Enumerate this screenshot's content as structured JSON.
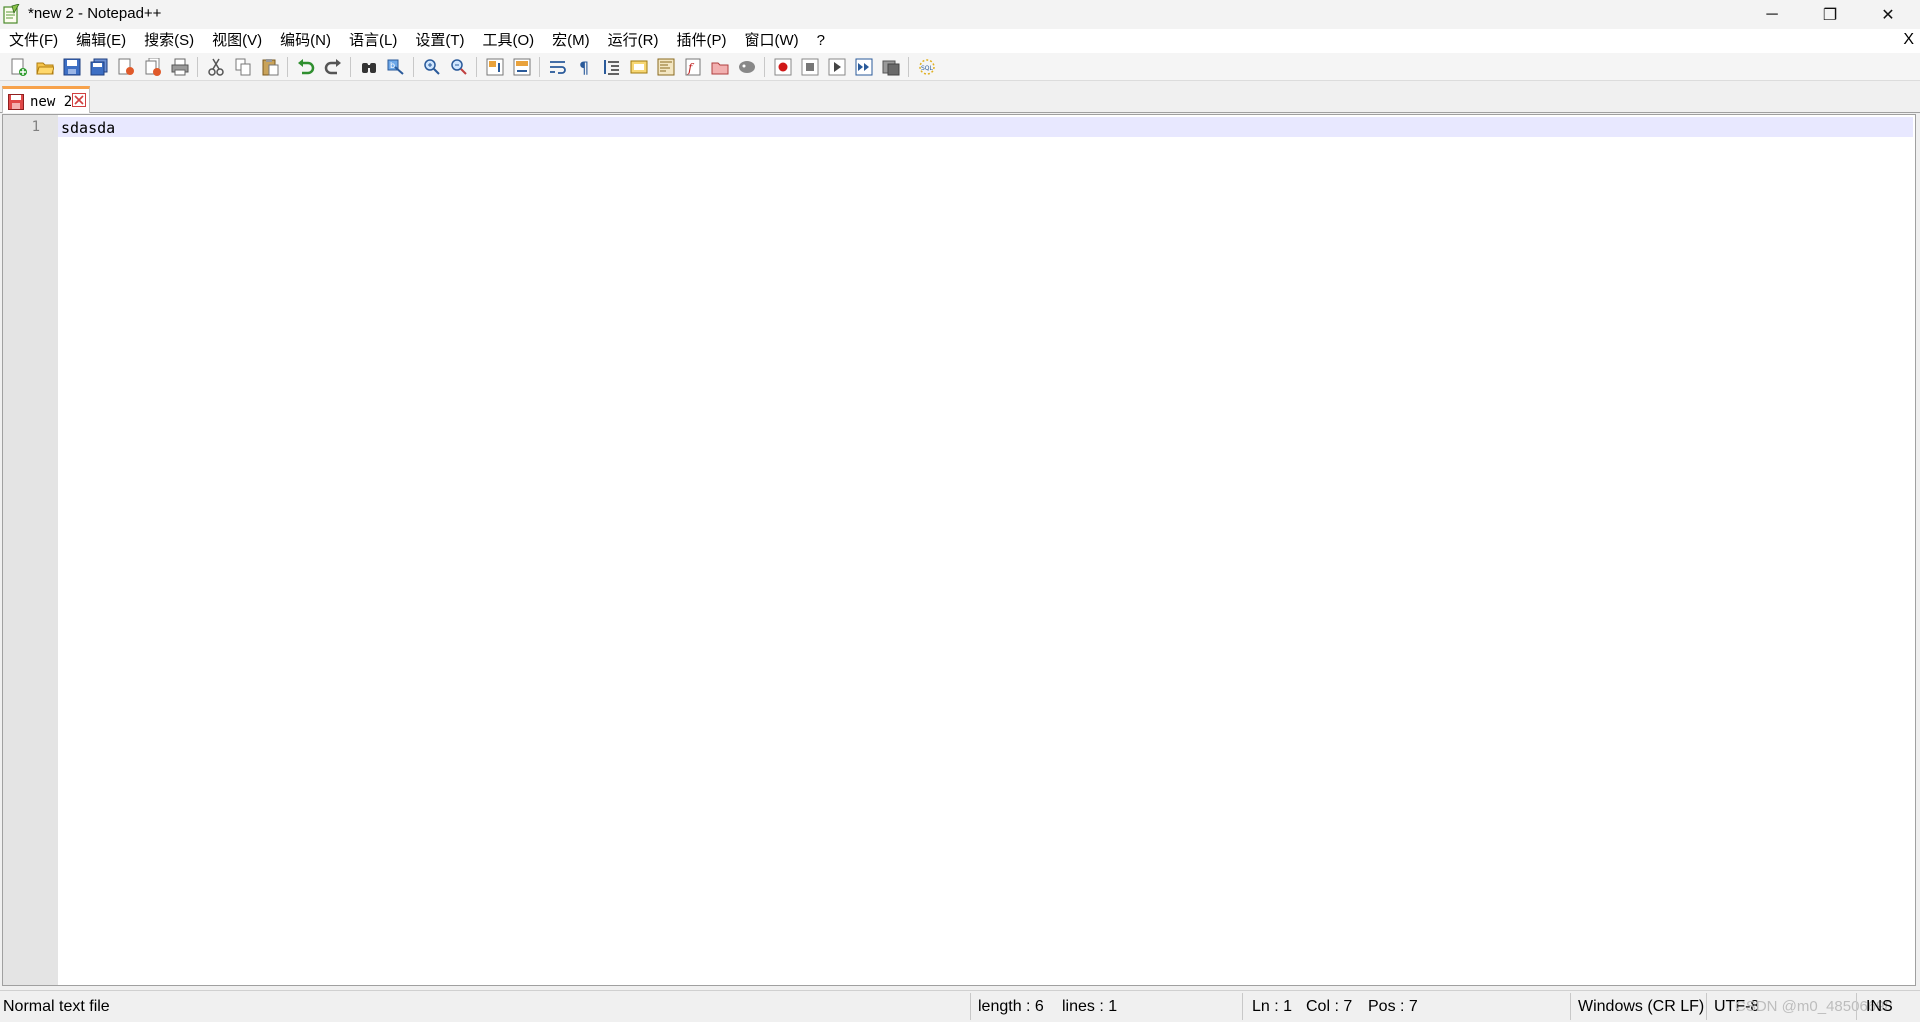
{
  "window": {
    "title": "*new 2 - Notepad++",
    "minimize_glyph": "─",
    "restore_glyph": "❐",
    "close_glyph": "✕"
  },
  "menu": {
    "items": [
      "文件(F)",
      "编辑(E)",
      "搜索(S)",
      "视图(V)",
      "编码(N)",
      "语言(L)",
      "设置(T)",
      "工具(O)",
      "宏(M)",
      "运行(R)",
      "插件(P)",
      "窗口(W)",
      "?"
    ],
    "close_label": "X"
  },
  "toolbar": {
    "icons": [
      "new-file",
      "open-file",
      "save",
      "save-all",
      "close",
      "close-all",
      "print",
      "cut",
      "copy",
      "paste",
      "undo",
      "redo",
      "find",
      "replace",
      "zoom-in",
      "zoom-out",
      "sync-vertical",
      "sync-horizontal",
      "word-wrap",
      "show-all-chars",
      "indent-guide",
      "user-defined-language",
      "document-map",
      "function-list",
      "folder-as-workspace",
      "monitoring",
      "record-macro",
      "stop-record",
      "play-macro",
      "run-macro-multiple",
      "save-macro",
      "sql-plugin"
    ]
  },
  "tab": {
    "label": "new 2"
  },
  "editor": {
    "line_number": "1",
    "line_text": "sdasda"
  },
  "status": {
    "file_type": "Normal text file",
    "length": "length : 6",
    "lines": "lines : 1",
    "ln": "Ln : 1",
    "col": "Col : 7",
    "pos": "Pos : 7",
    "eol": "Windows (CR LF)",
    "encoding": "UTF-8",
    "mode": "INS",
    "watermark": "CSDN @m0_48506698"
  },
  "colors": {
    "tab_accent": "#f7a24b",
    "current_line": "#e8e8ff",
    "gutter": "#e4e4e4"
  }
}
